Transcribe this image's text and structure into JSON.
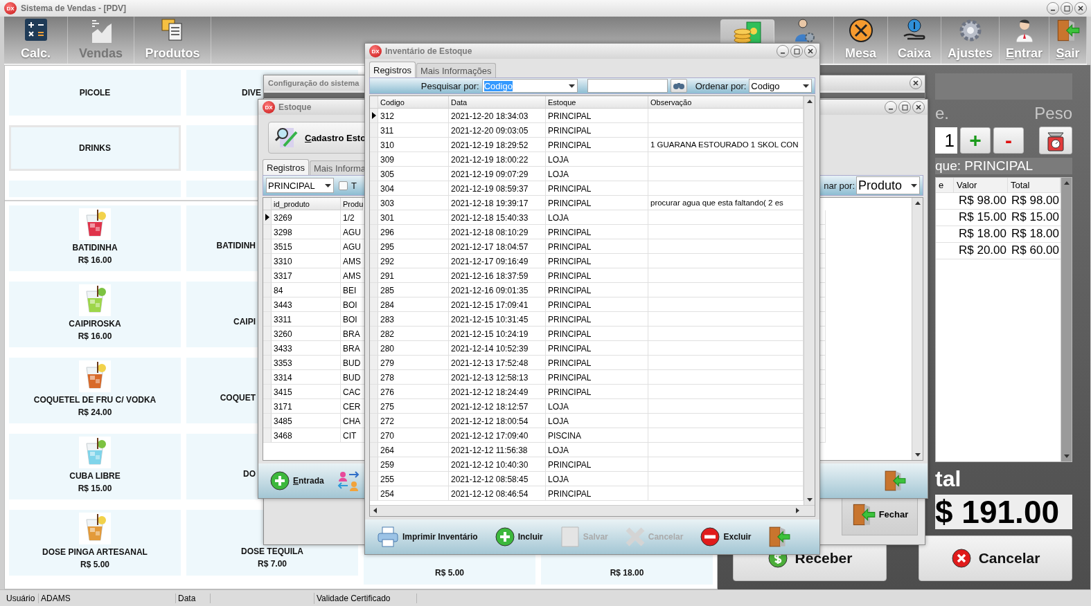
{
  "window": {
    "icon": "DX",
    "title": "Sistema de Vendas - [PDV]"
  },
  "toolbar_left": [
    {
      "label": "Calc.",
      "disabled": false
    },
    {
      "label": "Vendas",
      "disabled": true
    },
    {
      "label": "Produtos",
      "disabled": false
    }
  ],
  "toolbar_right": [
    {
      "selected": true
    },
    {
      "selected": false
    },
    {
      "label": "Mesa",
      "selected": false,
      "mnemonic": false
    },
    {
      "label": "Caixa",
      "selected": false,
      "mnemonic": false
    },
    {
      "label": "Ajustes",
      "selected": false,
      "mnemonic": false
    },
    {
      "label": "Entrar",
      "selected": false,
      "mnemonic": true
    },
    {
      "label": "Sair",
      "selected": false,
      "mnemonic": true
    }
  ],
  "categories": [
    {
      "label": "PICOLE",
      "kind": "full"
    },
    {
      "label": "DIVE",
      "kind": "partial"
    },
    {
      "label": "DRINKS",
      "kind": "outlined"
    }
  ],
  "product_columns": [
    [
      {
        "name": "BATIDINHA",
        "price": "R$ 16.00",
        "kind": "picture"
      },
      {
        "name": "CAIPIROSKA",
        "price": "R$ 16.00",
        "kind": "picture"
      },
      {
        "name": "COQUETEL DE FRU C/ VODKA",
        "price": "R$ 24.00",
        "kind": "picture"
      },
      {
        "name": "CUBA LIBRE",
        "price": "R$ 15.00",
        "kind": "picture"
      },
      {
        "name": "DOSE PINGA ARTESANAL",
        "price": "R$ 5.00",
        "kind": "picture"
      }
    ],
    [
      {
        "name": "BATIDINH",
        "kind": "partial"
      },
      {
        "name": "CAIPI",
        "kind": "partial"
      },
      {
        "name": "COQUET",
        "kind": "partial"
      },
      {
        "name": "DO",
        "kind": "partial"
      },
      {
        "name": "DOSE TEQUILA",
        "price": "R$ 7.00",
        "kind": "text"
      }
    ],
    [
      {
        "price": "R$ 5.00",
        "kind": "price"
      }
    ],
    [
      {
        "price": "R$ 18.00",
        "kind": "price"
      }
    ]
  ],
  "sale_panel": {
    "qty_label": "e.",
    "weight_label": "Peso",
    "quantity": "1",
    "plus": "+",
    "minus": "-",
    "stock_label": "que: PRINCIPAL",
    "columns": [
      "e",
      "Valor",
      "Total"
    ],
    "rows": [
      {
        "valor": "R$ 98.00",
        "total": "R$ 98.00"
      },
      {
        "valor": "R$ 15.00",
        "total": "R$ 15.00"
      },
      {
        "valor": "R$ 18.00",
        "total": "R$ 18.00"
      },
      {
        "valor": "R$ 20.00",
        "total": "R$ 60.00"
      }
    ],
    "total_label": "tal",
    "total": "$ 191.00",
    "buttons": [
      {
        "label": "Receber"
      },
      {
        "label": "Cancelar"
      }
    ]
  },
  "status_bar": [
    "Usuário",
    "ADAMS",
    "Data",
    "Validade Certificado"
  ],
  "config_window": {
    "title": "Configuração do sistema",
    "close_label": "Fechar"
  },
  "stock_window": {
    "icon": "DX",
    "title": "Estoque",
    "header_button": "Cadastro Esto",
    "tabs": [
      {
        "label": "Registros",
        "selected": true
      },
      {
        "label": "Mais Informa",
        "selected": false
      }
    ],
    "stock_filter": "PRINCIPAL",
    "checkbox": {
      "label": "T",
      "checked": false
    },
    "order_label": "nar por:",
    "order_by": "Produto",
    "columns": [
      "id_produto",
      "Produ"
    ],
    "rows": [
      {
        "id": "3269",
        "produto": "1/2",
        "selected": true
      },
      {
        "id": "3298",
        "produto": "AGU",
        "selected": false
      },
      {
        "id": "3515",
        "produto": "AGU",
        "selected": false
      },
      {
        "id": "3310",
        "produto": "AMS",
        "selected": false
      },
      {
        "id": "3317",
        "produto": "AMS",
        "selected": false
      },
      {
        "id": "84",
        "produto": "BEI",
        "selected": false
      },
      {
        "id": "3443",
        "produto": "BOI",
        "selected": false
      },
      {
        "id": "3311",
        "produto": "BOI",
        "selected": false
      },
      {
        "id": "3260",
        "produto": "BRA",
        "selected": false
      },
      {
        "id": "3433",
        "produto": "BRA",
        "selected": false
      },
      {
        "id": "3353",
        "produto": "BUD",
        "selected": false
      },
      {
        "id": "3314",
        "produto": "BUD",
        "selected": false
      },
      {
        "id": "3415",
        "produto": "CAC",
        "selected": false
      },
      {
        "id": "3171",
        "produto": "CER",
        "selected": false
      },
      {
        "id": "3485",
        "produto": "CHA",
        "selected": false
      },
      {
        "id": "3468",
        "produto": "CIT",
        "selected": false
      }
    ],
    "entry_button": "Entrada"
  },
  "inventory_window": {
    "icon": "DX",
    "title": "Inventário de Estoque",
    "tabs": [
      {
        "label": "Registros",
        "selected": true
      },
      {
        "label": "Mais Informações",
        "selected": false
      }
    ],
    "search_label": "Pesquisar por:",
    "search_by": "Codigo",
    "search_by_highlighted": true,
    "order_label": "Ordenar por:",
    "order_by": "Codigo",
    "columns": [
      "Codigo",
      "Data",
      "Estoque",
      "Observação"
    ],
    "rows": [
      {
        "codigo": "312",
        "data": "2021-12-20 18:34:03",
        "estoque": "PRINCIPAL",
        "selected": true
      },
      {
        "codigo": "311",
        "data": "2021-12-20 09:03:05",
        "estoque": "PRINCIPAL",
        "selected": false
      },
      {
        "codigo": "310",
        "data": "2021-12-19 18:29:52",
        "estoque": "PRINCIPAL",
        "observacao": "1 GUARANA ESTOURADO 1 SKOL CON",
        "selected": false
      },
      {
        "codigo": "309",
        "data": "2021-12-19 18:00:22",
        "estoque": "LOJA",
        "selected": false
      },
      {
        "codigo": "305",
        "data": "2021-12-19 09:07:29",
        "estoque": "LOJA",
        "selected": false
      },
      {
        "codigo": "304",
        "data": "2021-12-19 08:59:37",
        "estoque": "PRINCIPAL",
        "selected": false
      },
      {
        "codigo": "303",
        "data": "2021-12-18 19:39:17",
        "estoque": "PRINCIPAL",
        "observacao": "procurar agua que esta faltando( 2 es",
        "selected": false
      },
      {
        "codigo": "301",
        "data": "2021-12-18 15:40:33",
        "estoque": "LOJA",
        "selected": false
      },
      {
        "codigo": "296",
        "data": "2021-12-18 08:10:29",
        "estoque": "PRINCIPAL",
        "selected": false
      },
      {
        "codigo": "295",
        "data": "2021-12-17 18:04:57",
        "estoque": "PRINCIPAL",
        "selected": false
      },
      {
        "codigo": "292",
        "data": "2021-12-17 09:16:49",
        "estoque": "PRINCIPAL",
        "selected": false
      },
      {
        "codigo": "291",
        "data": "2021-12-16 18:37:59",
        "estoque": "PRINCIPAL",
        "selected": false
      },
      {
        "codigo": "285",
        "data": "2021-12-16 09:01:35",
        "estoque": "PRINCIPAL",
        "selected": false
      },
      {
        "codigo": "284",
        "data": "2021-12-15 17:09:41",
        "estoque": "PRINCIPAL",
        "selected": false
      },
      {
        "codigo": "283",
        "data": "2021-12-15 10:31:45",
        "estoque": "PRINCIPAL",
        "selected": false
      },
      {
        "codigo": "282",
        "data": "2021-12-15 10:24:19",
        "estoque": "PRINCIPAL",
        "selected": false
      },
      {
        "codigo": "280",
        "data": "2021-12-14 10:52:39",
        "estoque": "PRINCIPAL",
        "selected": false
      },
      {
        "codigo": "279",
        "data": "2021-12-13 17:52:48",
        "estoque": "PRINCIPAL",
        "selected": false
      },
      {
        "codigo": "278",
        "data": "2021-12-13 12:58:13",
        "estoque": "PRINCIPAL",
        "selected": false
      },
      {
        "codigo": "276",
        "data": "2021-12-12 18:24:49",
        "estoque": "PRINCIPAL",
        "selected": false
      },
      {
        "codigo": "275",
        "data": "2021-12-12 18:12:57",
        "estoque": "LOJA",
        "selected": false
      },
      {
        "codigo": "272",
        "data": "2021-12-12 18:00:54",
        "estoque": "LOJA",
        "selected": false
      },
      {
        "codigo": "270",
        "data": "2021-12-12 17:09:40",
        "estoque": "PISCINA",
        "selected": false
      },
      {
        "codigo": "264",
        "data": "2021-12-12 11:56:38",
        "estoque": "LOJA",
        "selected": false
      },
      {
        "codigo": "259",
        "data": "2021-12-12 10:40:30",
        "estoque": "PRINCIPAL",
        "selected": false
      },
      {
        "codigo": "255",
        "data": "2021-12-12 08:58:45",
        "estoque": "LOJA",
        "selected": false
      },
      {
        "codigo": "254",
        "data": "2021-12-12 08:46:54",
        "estoque": "PRINCIPAL",
        "selected": false
      }
    ],
    "buttons": [
      {
        "label": "Imprimir Inventário",
        "disabled": false
      },
      {
        "label": "Incluir",
        "disabled": false
      },
      {
        "label": "Salvar",
        "disabled": true
      },
      {
        "label": "Cancelar",
        "disabled": true
      },
      {
        "label": "Excluir",
        "disabled": false
      }
    ]
  }
}
